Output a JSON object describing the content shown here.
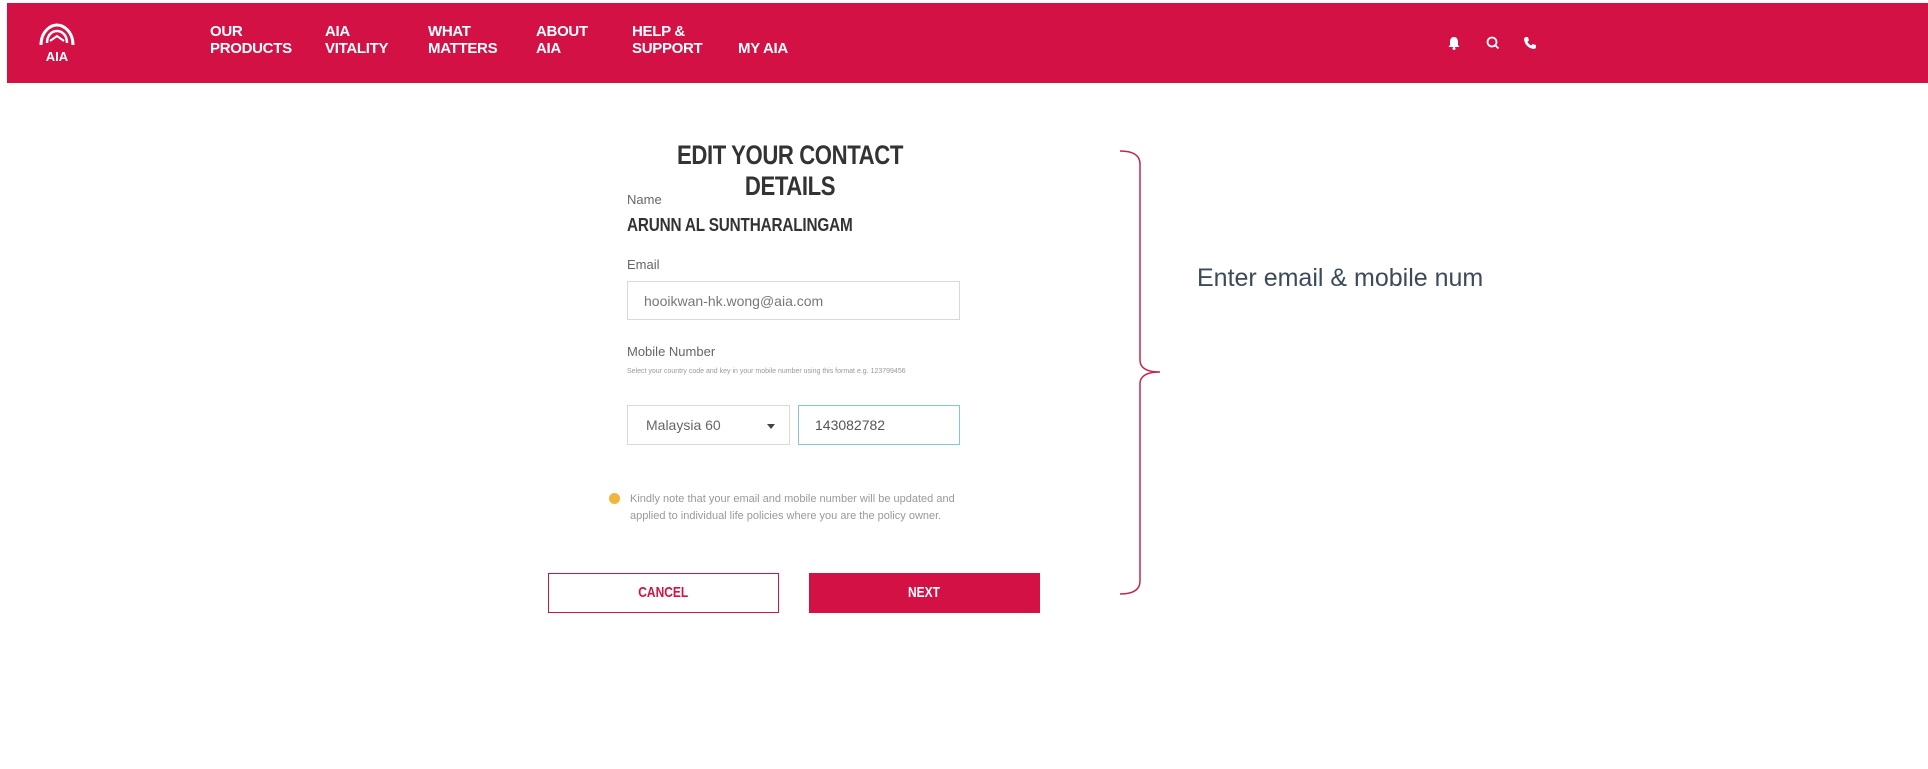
{
  "nav": {
    "items": [
      {
        "line1": "OUR",
        "line2": "PRODUCTS"
      },
      {
        "line1": "AIA",
        "line2": "VITALITY"
      },
      {
        "line1": "WHAT",
        "line2": "MATTERS"
      },
      {
        "line1": "ABOUT",
        "line2": "AIA"
      },
      {
        "line1": "HELP &",
        "line2": "SUPPORT"
      },
      {
        "line1": "",
        "line2": "MY AIA"
      }
    ],
    "icons": [
      "bell-icon",
      "search-icon",
      "phone-icon"
    ],
    "brand_color": "#d31145"
  },
  "form": {
    "title": "EDIT YOUR CONTACT DETAILS",
    "name_label": "Name",
    "name_value": "ARUNN AL SUNTHARALINGAM",
    "email_label": "Email",
    "email_value": "hooikwan-hk.wong@aia.com",
    "mobile_label": "Mobile Number",
    "mobile_helper": "Select your country code and key in your mobile number using this format e.g. 123799456",
    "country_value": "Malaysia 60",
    "mobile_value": "143082782",
    "note": "Kindly note that your email and mobile number will be updated and applied to individual life policies where you are the policy owner.",
    "cancel_label": "CANCEL",
    "next_label": "NEXT"
  },
  "annotation": {
    "text": "Enter email & mobile num"
  }
}
